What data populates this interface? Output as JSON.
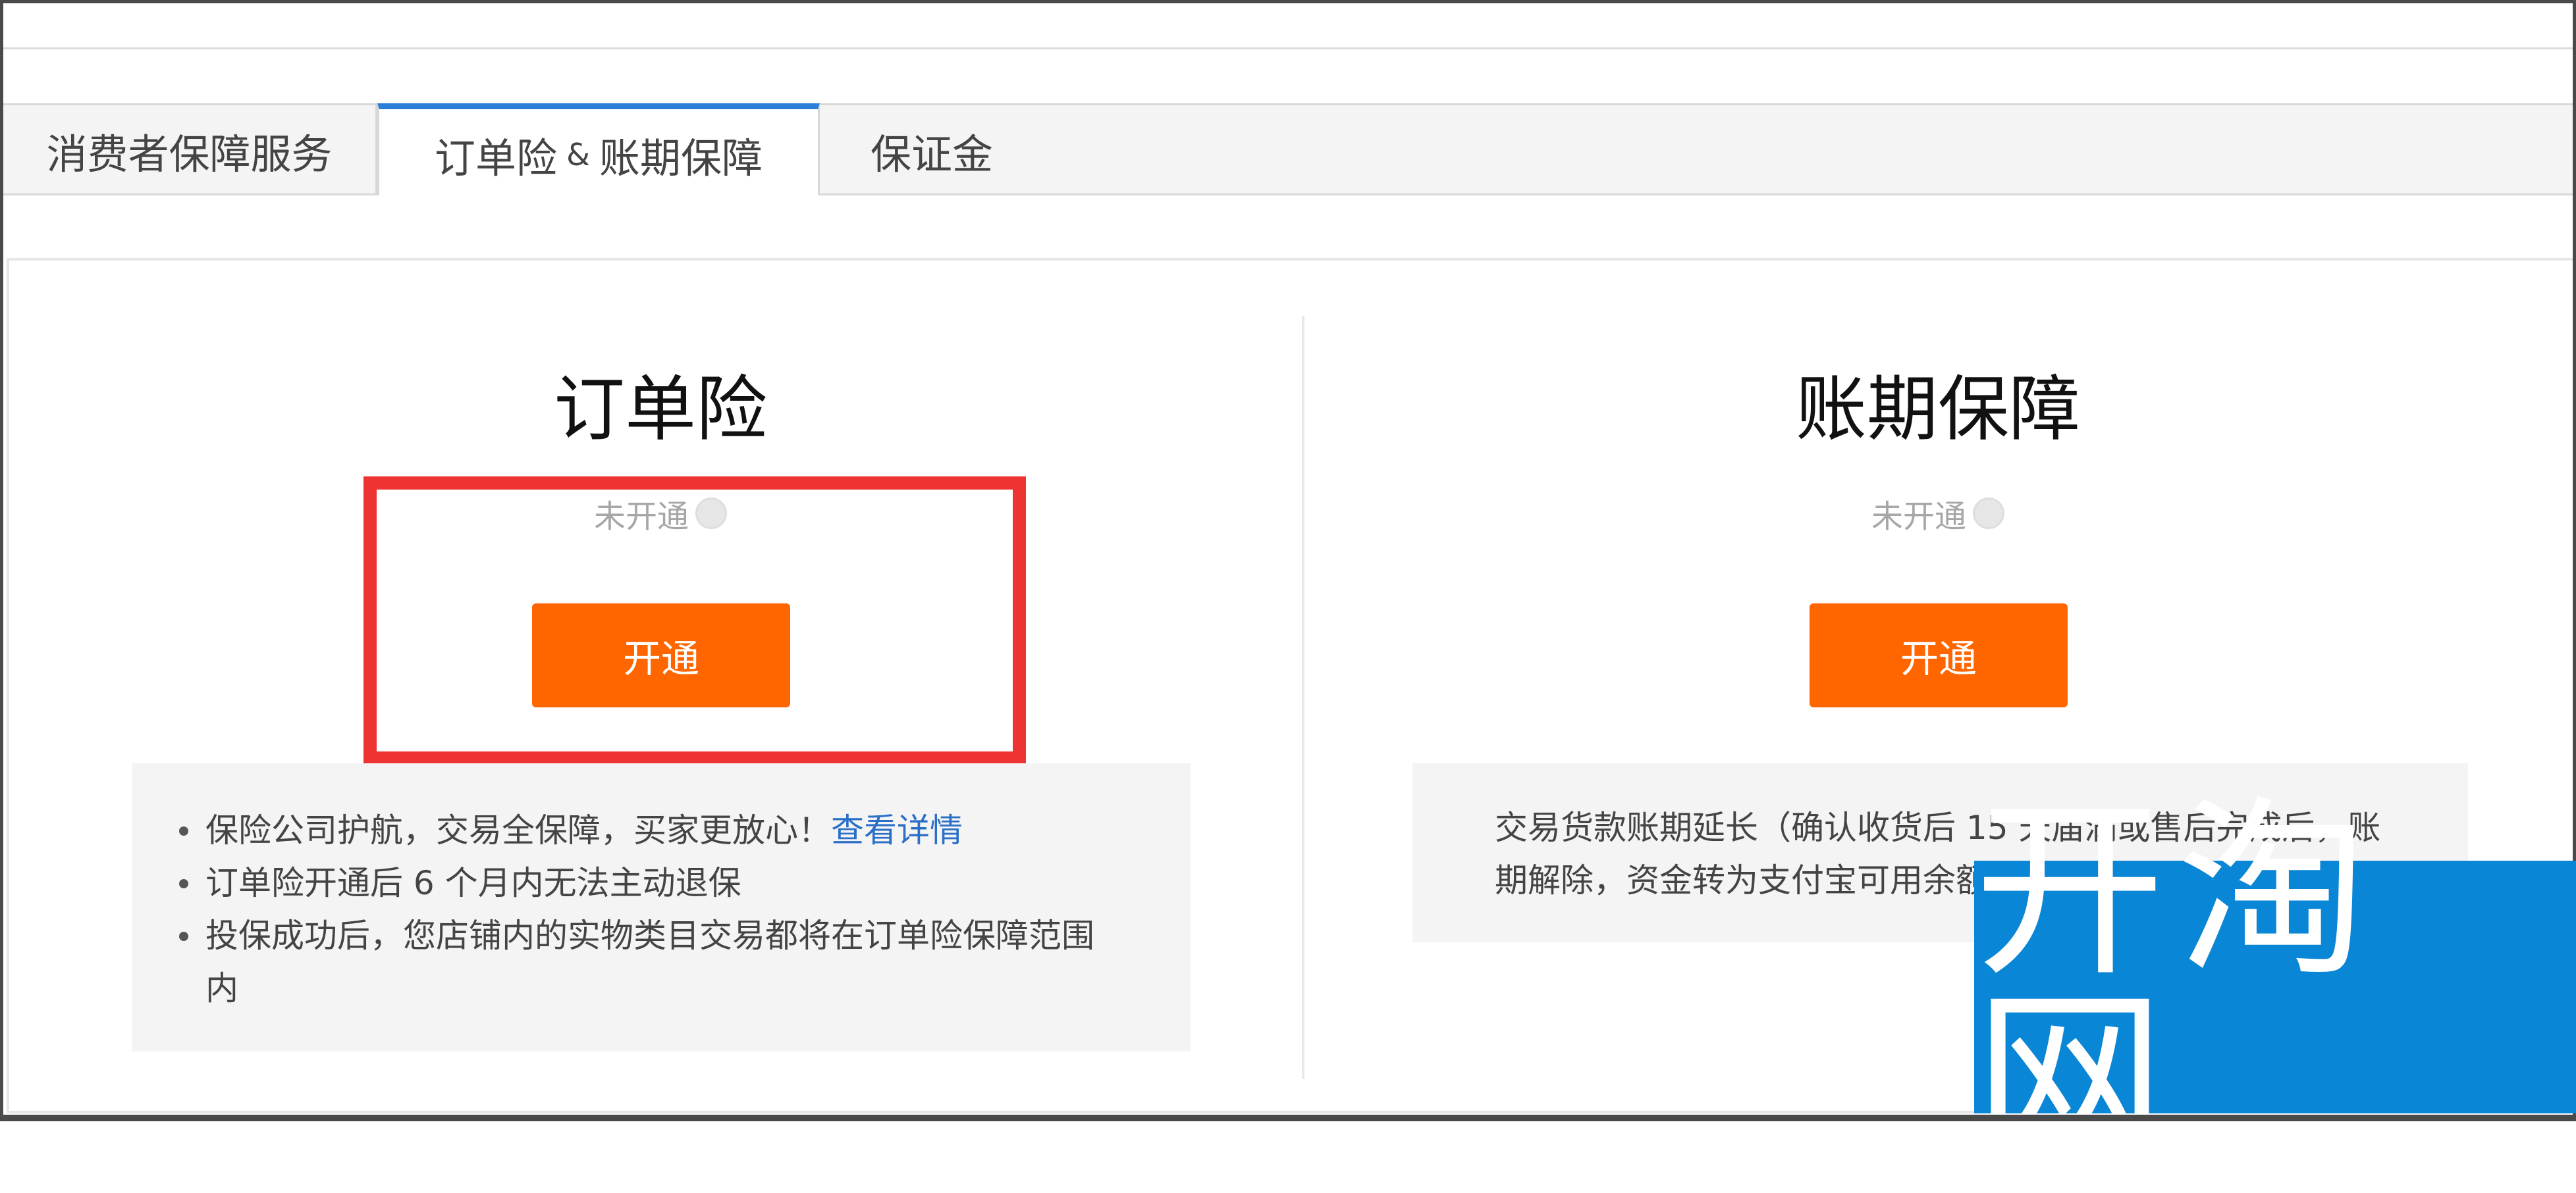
{
  "tabs": [
    {
      "label": "消费者保障服务"
    },
    {
      "label_a": "订单险",
      "amp": "&",
      "label_b": "账期保障"
    },
    {
      "label": "保证金"
    }
  ],
  "left_card": {
    "title": "订单险",
    "status": "未开通",
    "button": "开通",
    "bullets": [
      {
        "text": "保险公司护航，交易全保障，买家更放心！",
        "link": "查看详情"
      },
      {
        "text": "订单险开通后 6 个月内无法主动退保"
      },
      {
        "text": "投保成功后，您店铺内的实物类目交易都将在订单险保障范围内"
      }
    ]
  },
  "right_card": {
    "title": "账期保障",
    "status": "未开通",
    "button": "开通",
    "description": "交易货款账期延长（确认收货后 15 天届满或售后完成后，账期解除，资金转为支付宝可用余额"
  },
  "watermark": {
    "text": "开淘网"
  },
  "colors": {
    "accent": "#ff6600",
    "tab_active": "#2b7fd6",
    "highlight": "#ee3333",
    "watermark_bg": "#0a86d6"
  }
}
